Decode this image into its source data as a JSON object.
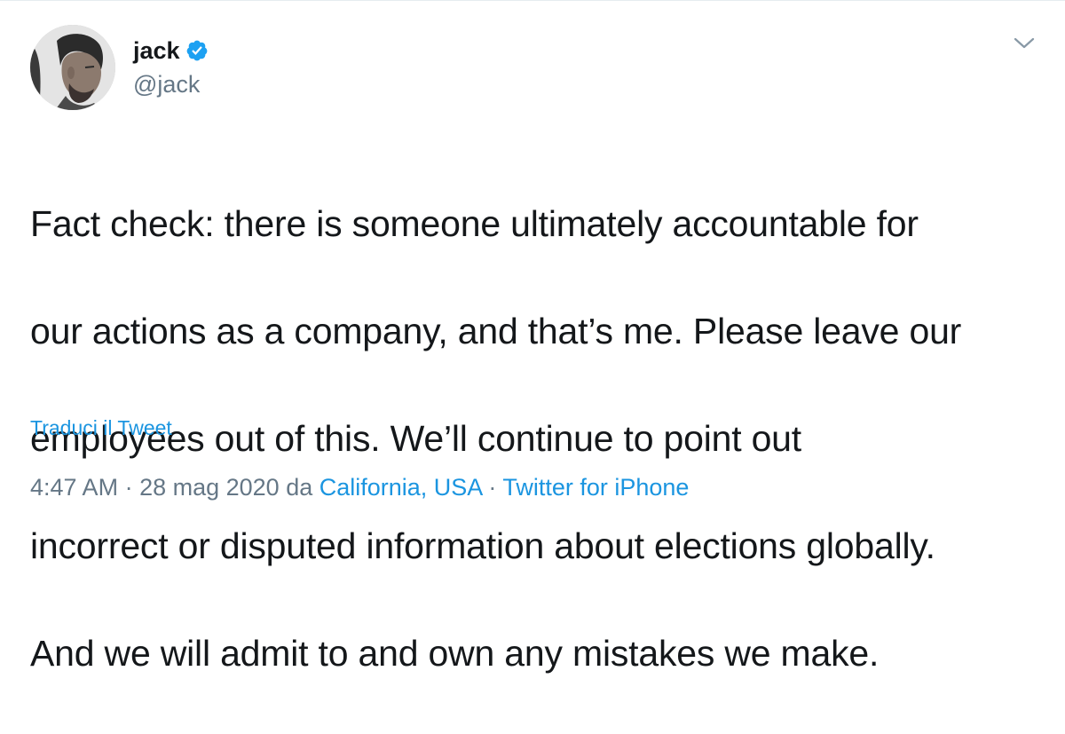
{
  "tweet": {
    "author": {
      "display_name": "jack",
      "handle": "@jack",
      "verified": true
    },
    "text_lines": [
      "Fact check: there is someone ultimately accountable for",
      "our actions as a company, and that’s me. Please leave our",
      "employees out of this. We’ll continue to point out",
      "incorrect or disputed information about elections globally.",
      "And we will admit to and own any mistakes we make."
    ],
    "translate_label": "Traduci il Tweet",
    "meta": {
      "time": "4:47 AM",
      "separator1": " · ",
      "date": "28 mag 2020",
      "from_label": " da ",
      "location": "California, USA",
      "separator2": " · ",
      "source": "Twitter for iPhone"
    }
  },
  "colors": {
    "text": "#14171a",
    "secondary": "#657786",
    "link": "#1b95e0",
    "verified": "#1da1f2"
  },
  "icons": {
    "verified": "verified-badge-icon",
    "menu": "chevron-down-icon"
  }
}
